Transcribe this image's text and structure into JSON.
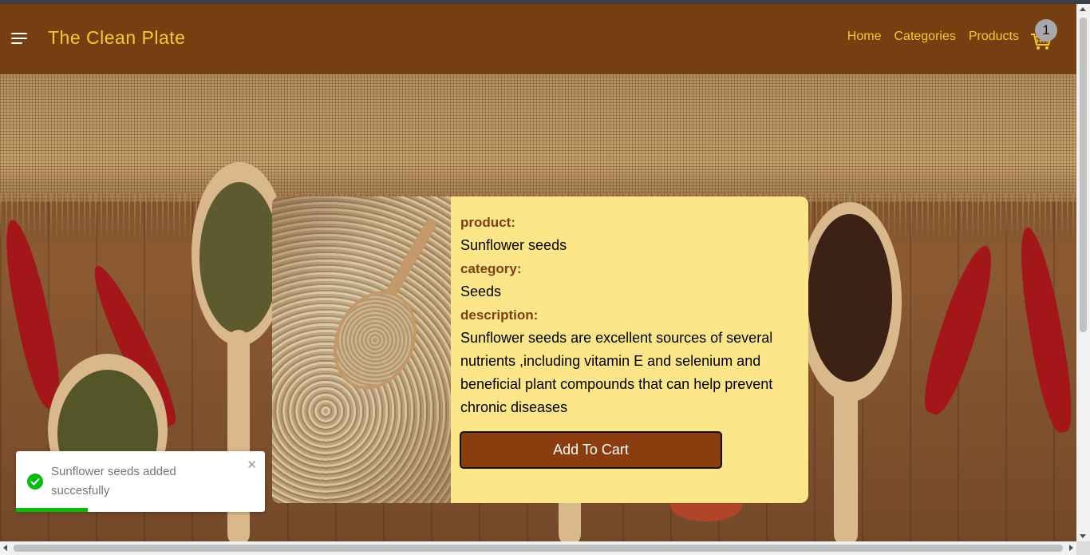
{
  "navbar": {
    "menu_icon": "hamburger-menu-icon",
    "brand": "The Clean Plate",
    "links": [
      "Home",
      "Categories",
      "Products"
    ],
    "cart_icon": "shopping-cart-icon",
    "cart_count": "1",
    "colors": {
      "background": "#763f12",
      "text": "#f7c92e"
    }
  },
  "product": {
    "product_label": "product:",
    "product_name": "Sunflower seeds",
    "category_label": "category:",
    "category_value": "Seeds",
    "description_label": "description:",
    "description_value": "Sunflower seeds are excellent sources of several nutrients ,including vitamin E and selenium and beneficial plant compounds that can help prevent chronic diseases",
    "add_to_cart_label": "Add To Cart",
    "colors": {
      "card": "#fde68a",
      "label": "#7a3f10",
      "button": "#8c3d0f"
    }
  },
  "toast": {
    "icon": "success-check-icon",
    "message": "Sunflower seeds added succesfully",
    "close_icon": "close-icon",
    "progress": 0.29,
    "color": "#07bc0c"
  }
}
